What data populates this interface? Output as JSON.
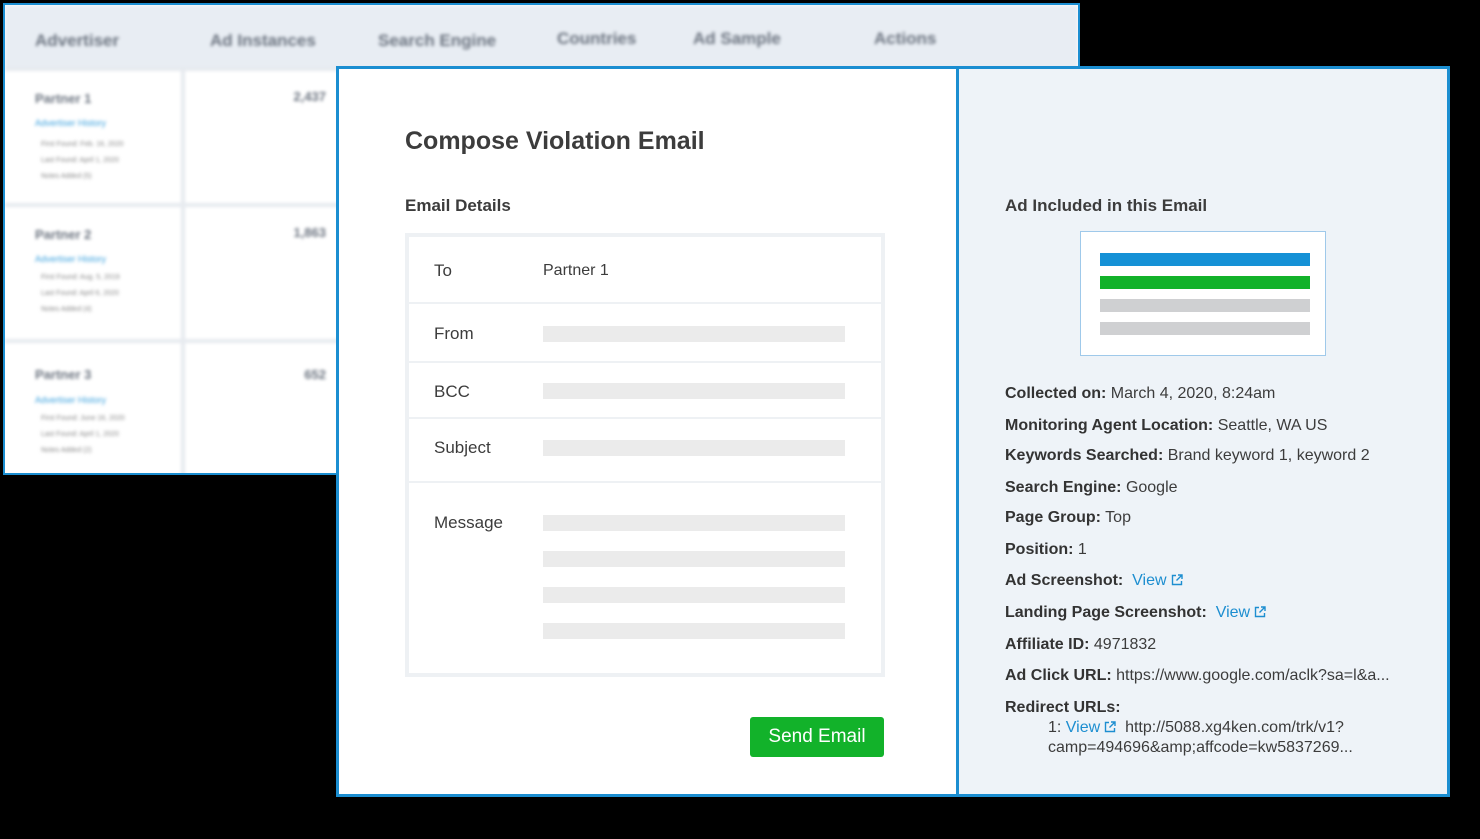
{
  "background_table": {
    "headers": [
      "Advertiser",
      "Ad Instances",
      "Search Engine",
      "Countries",
      "Ad Sample",
      "Actions"
    ],
    "rows": [
      {
        "partner": "Partner 1",
        "history_link": "Advertiser History",
        "first_found": "First Found: Feb. 16, 2020",
        "last_found": "Last Found: April 1, 2020",
        "notes": "Notes Added (5)",
        "instances": "2,437"
      },
      {
        "partner": "Partner 2",
        "history_link": "Advertiser History",
        "first_found": "First Found: Aug. 5, 2019",
        "last_found": "Last Found: April 6, 2020",
        "notes": "Notes Added (4)",
        "instances": "1,863"
      },
      {
        "partner": "Partner 3",
        "history_link": "Advertiser History",
        "first_found": "First Found: June 16, 2020",
        "last_found": "Last Found: April 1, 2020",
        "notes": "Notes Added (2)",
        "instances": "652"
      }
    ]
  },
  "compose": {
    "title": "Compose Violation Email",
    "details_title": "Email Details",
    "fields": {
      "to_label": "To",
      "to_value": "Partner 1",
      "from_label": "From",
      "bcc_label": "BCC",
      "subject_label": "Subject",
      "message_label": "Message"
    },
    "send_label": "Send Email"
  },
  "ad_panel": {
    "title": "Ad Included in this Email",
    "preview_colors": [
      "#1591d6",
      "#12b22a",
      "#cfd0d2",
      "#cfd0d2"
    ],
    "collected_label": "Collected on:",
    "collected_value": "March 4, 2020, 8:24am",
    "location_label": "Monitoring Agent Location:",
    "location_value": "Seattle, WA US",
    "keywords_label": "Keywords Searched:",
    "keywords_value": "Brand keyword 1, keyword 2",
    "engine_label": "Search Engine:",
    "engine_value": "Google",
    "page_group_label": "Page Group:",
    "page_group_value": "Top",
    "position_label": "Position:",
    "position_value": "1",
    "ad_screenshot_label": "Ad Screenshot:",
    "ad_screenshot_link": "View",
    "landing_label": "Landing Page Screenshot:",
    "landing_link": "View",
    "affiliate_label": "Affiliate ID:",
    "affiliate_value": "4971832",
    "click_url_label": "Ad Click URL:",
    "click_url_value": "https://www.google.com/aclk?sa=l&a...",
    "redirect_label": "Redirect URLs:",
    "redirect_index": "1:",
    "redirect_link": "View",
    "redirect_url_line1": "http://5088.xg4ken.com/trk/v1?",
    "redirect_url_line2": "camp=494696&amp;affcode=kw5837269..."
  }
}
